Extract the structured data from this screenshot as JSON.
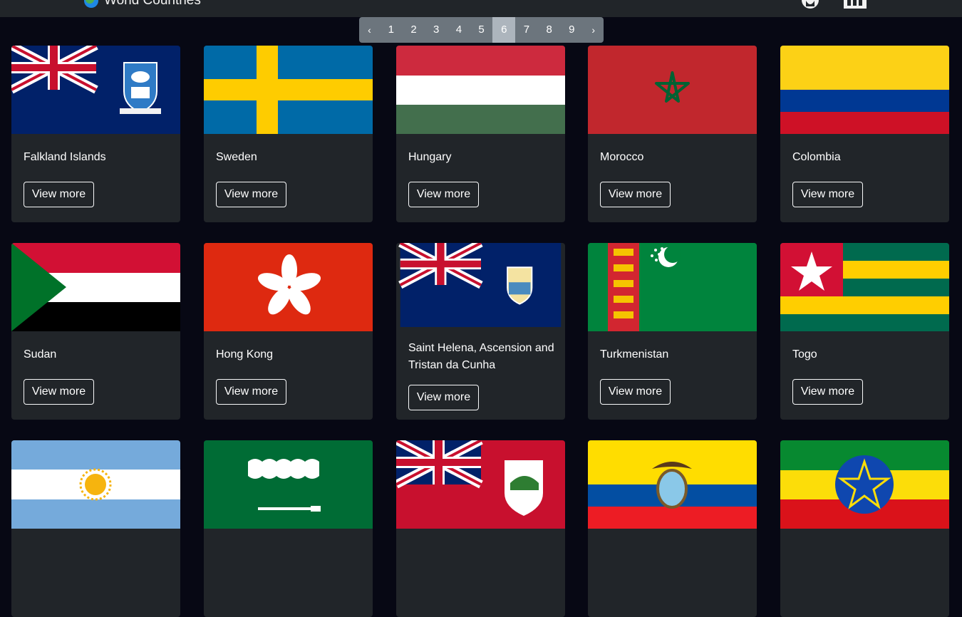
{
  "header": {
    "title": "World Countries"
  },
  "pagination": {
    "prev": "‹",
    "next": "›",
    "pages": [
      "1",
      "2",
      "3",
      "4",
      "5",
      "6",
      "7",
      "8",
      "9"
    ],
    "current": "6"
  },
  "button_label": "View more",
  "countries": [
    {
      "name": "Falkland Islands"
    },
    {
      "name": "Sweden"
    },
    {
      "name": "Hungary"
    },
    {
      "name": "Morocco"
    },
    {
      "name": "Colombia"
    },
    {
      "name": "Sudan"
    },
    {
      "name": "Hong Kong"
    },
    {
      "name": "Saint Helena, Ascension and Tristan da Cunha"
    },
    {
      "name": "Turkmenistan"
    },
    {
      "name": "Togo"
    },
    {
      "name": ""
    },
    {
      "name": ""
    },
    {
      "name": ""
    },
    {
      "name": ""
    },
    {
      "name": ""
    }
  ]
}
